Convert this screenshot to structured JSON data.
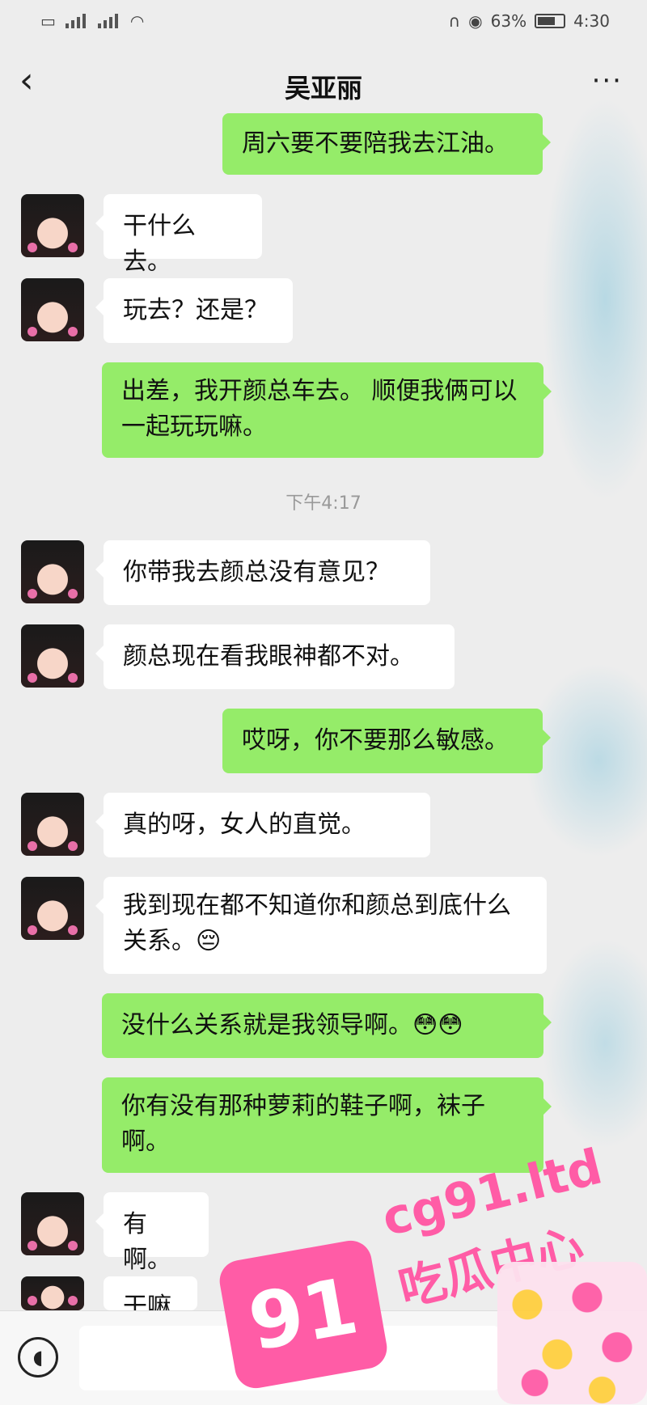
{
  "status_bar": {
    "battery": "63%",
    "time": "4:30"
  },
  "header": {
    "title": "吴亚丽",
    "back_icon": "‹",
    "more_icon": "···"
  },
  "messages": [
    {
      "side": "right",
      "text": "周六要不要陪我去江油。"
    },
    {
      "side": "left",
      "text": "干什么去。"
    },
    {
      "side": "left",
      "text": "玩去？还是？"
    },
    {
      "side": "right",
      "text": "出差，我开颜总车去。 顺便我俩可以一起玩玩嘛。"
    },
    {
      "side": "left",
      "text": "你带我去颜总没有意见？"
    },
    {
      "side": "left",
      "text": "颜总现在看我眼神都不对。"
    },
    {
      "side": "right",
      "text": "哎呀，你不要那么敏感。"
    },
    {
      "side": "left",
      "text": "真的呀，女人的直觉。"
    },
    {
      "side": "left",
      "text": "我到现在都不知道你和颜总到底什么关系。😔"
    },
    {
      "side": "right",
      "text": "没什么关系就是我领导啊。😳😳"
    },
    {
      "side": "right",
      "text": "你有没有那种萝莉的鞋子啊，袜子啊。"
    },
    {
      "side": "left",
      "text": "有啊。"
    },
    {
      "side": "left",
      "text": "干嘛"
    }
  ],
  "timestamp": "下午4:17",
  "watermark": {
    "url": "cg91.ltd",
    "name": "吃瓜中心",
    "logo": "91"
  }
}
